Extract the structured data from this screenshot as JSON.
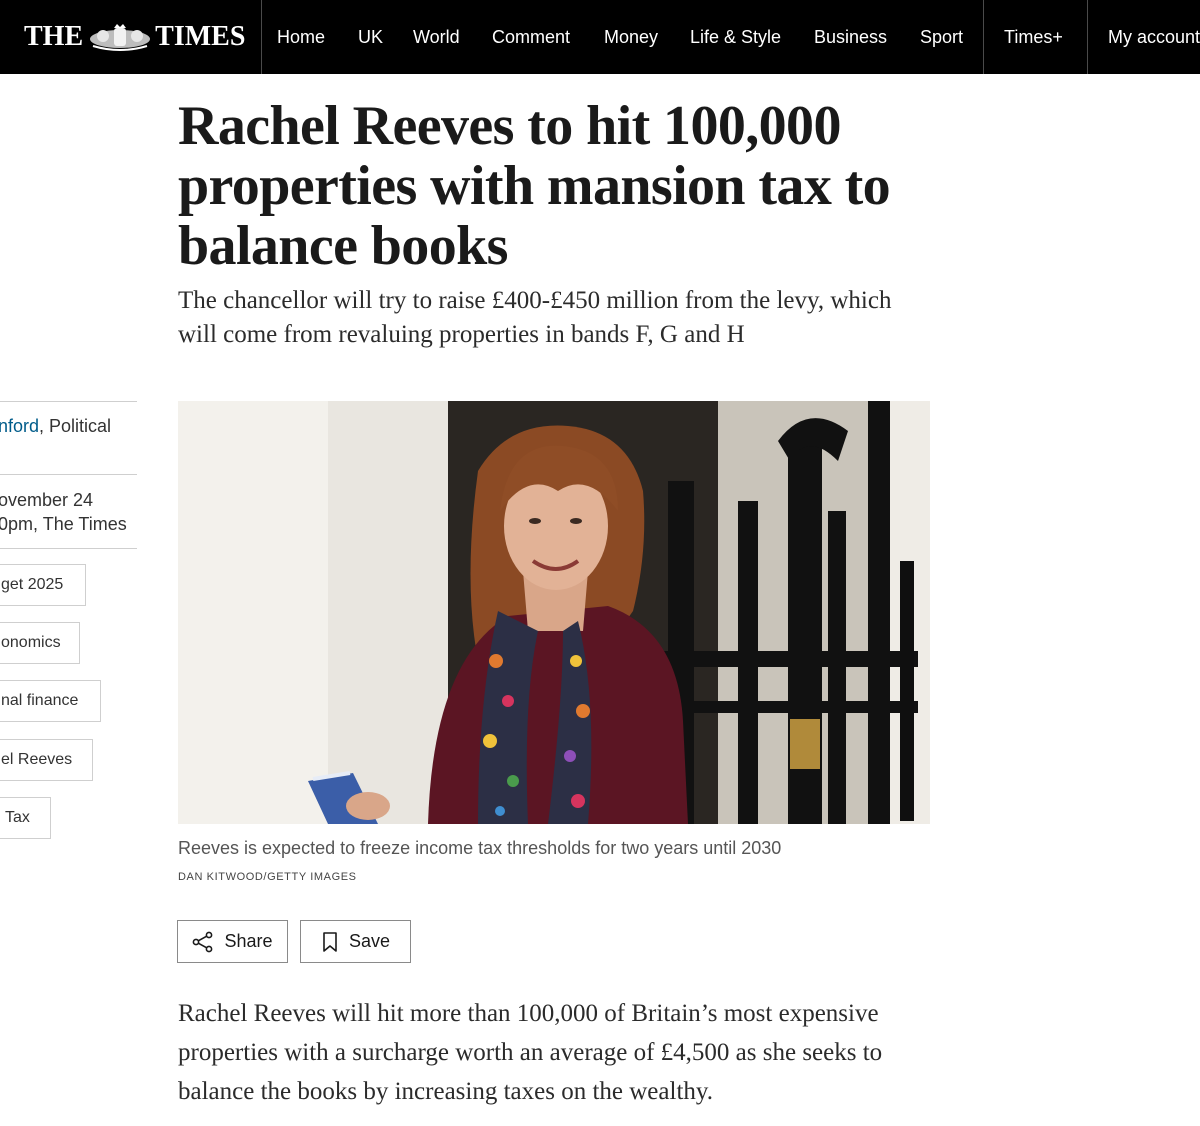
{
  "nav": {
    "logo_left": "THE",
    "logo_right": "TIMES",
    "links": [
      "Home",
      "UK",
      "World",
      "Comment",
      "Money",
      "Life & Style",
      "Business",
      "Sport"
    ],
    "times_plus": "Times+",
    "account": "My account"
  },
  "article": {
    "headline": "Rachel Reeves to hit 100,000 properties with mansion tax to balance books",
    "standfirst": "The chancellor will try to raise £400-£450 million from the levy, which will come from revaluing properties in bands F, G and H",
    "image_caption": "Reeves is expected to freeze income tax thresholds for two years until 2030",
    "image_credit": "Dan Kitwood/Getty Images",
    "body_first_paragraph": "Rachel Reeves will hit more than 100,000 of Britain’s most expensive properties with a surcharge worth an average of £4,500 as she seeks to balance the books by increasing taxes on the wealthy."
  },
  "sidebar": {
    "author_name_fragment": "nford",
    "author_role_fragment": ", Political",
    "date_line1": "ovember 24",
    "date_line2": "0pm, The Times",
    "tags": [
      "get 2025",
      "onomics",
      "nal finance",
      "el Reeves",
      "Tax"
    ]
  },
  "actions": {
    "share_label": "Share",
    "save_label": "Save"
  },
  "colors": {
    "nav_bg": "#000000",
    "link_blue": "#005c8a",
    "text": "#1a1a1a"
  }
}
